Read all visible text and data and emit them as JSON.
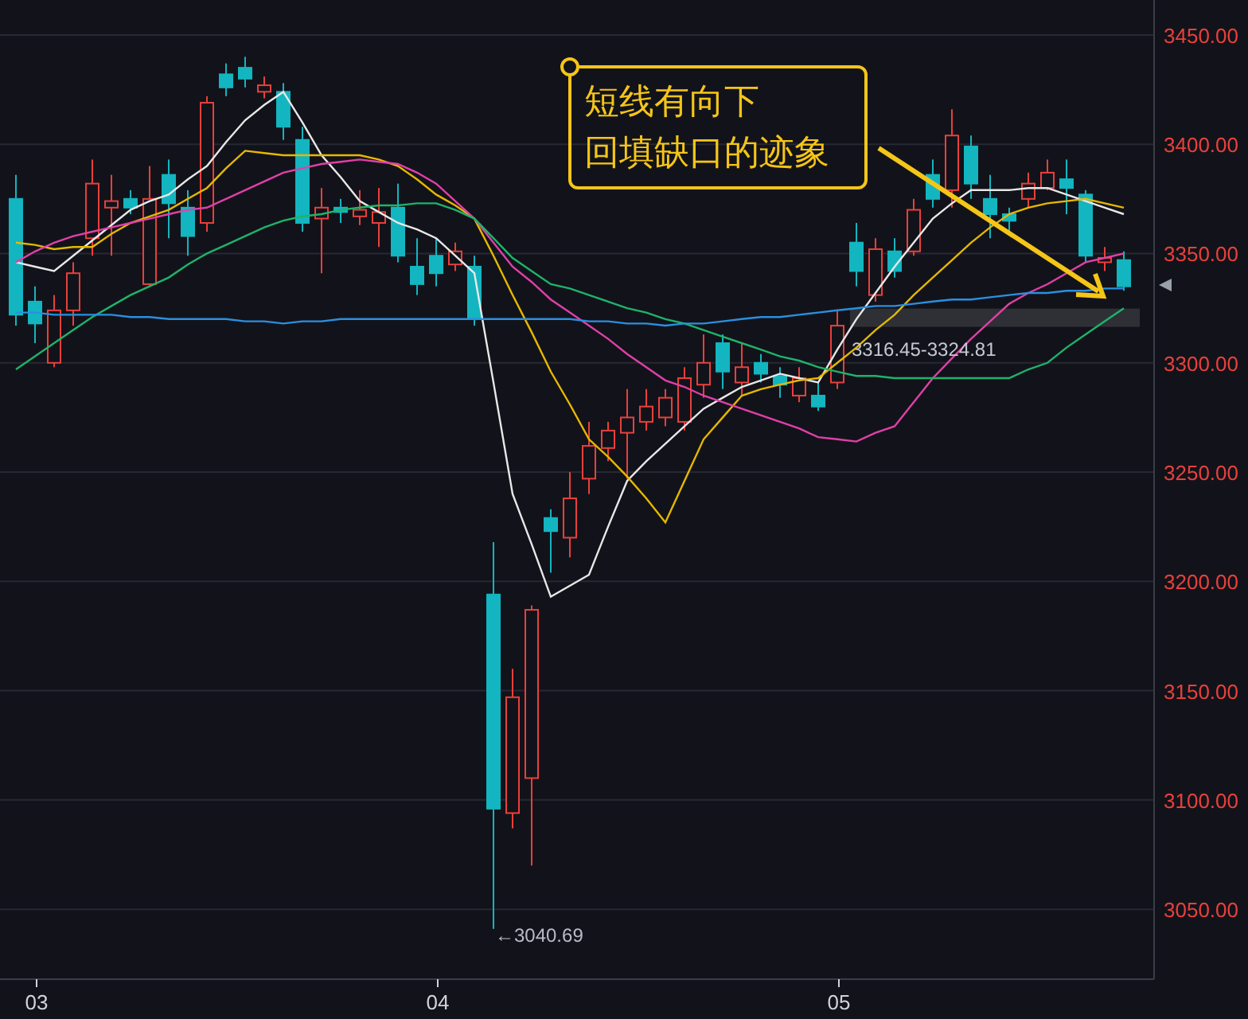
{
  "chart_data": {
    "type": "candlestick",
    "ylim": [
      3018,
      3466
    ],
    "grid": true,
    "categories": [
      null,
      "03",
      null,
      null,
      null,
      null,
      null,
      null,
      null,
      null,
      null,
      null,
      null,
      null,
      null,
      null,
      null,
      null,
      null,
      null,
      null,
      null,
      "04",
      null,
      null,
      null,
      null,
      null,
      null,
      null,
      null,
      null,
      null,
      null,
      null,
      null,
      null,
      null,
      null,
      null,
      null,
      null,
      null,
      "05",
      null,
      null,
      null,
      null,
      null,
      null,
      null,
      null,
      null,
      null,
      null,
      null,
      null,
      null,
      null
    ],
    "yticks": [
      {
        "value": 3450,
        "label": "3450.00"
      },
      {
        "value": 3400,
        "label": "3400.00"
      },
      {
        "value": 3350,
        "label": "3350.00"
      },
      {
        "value": 3300,
        "label": "3300.00"
      },
      {
        "value": 3250,
        "label": "3250.00"
      },
      {
        "value": 3200,
        "label": "3200.00"
      },
      {
        "value": 3150,
        "label": "3150.00"
      },
      {
        "value": 3100,
        "label": "3100.00"
      },
      {
        "value": 3050,
        "label": "3050.00"
      }
    ],
    "ohlc": [
      [
        3375,
        3386,
        3317,
        3322
      ],
      [
        3328,
        3335,
        3309,
        3318
      ],
      [
        3300,
        3331,
        3298,
        3324
      ],
      [
        3324,
        3346,
        3317,
        3341
      ],
      [
        3357,
        3393,
        3349,
        3382
      ],
      [
        3371,
        3386,
        3349,
        3374
      ],
      [
        3375,
        3379,
        3368,
        3371
      ],
      [
        3336,
        3390,
        3335,
        3375
      ],
      [
        3386,
        3393,
        3357,
        3373
      ],
      [
        3371,
        3379,
        3349,
        3358
      ],
      [
        3364,
        3422,
        3360,
        3419
      ],
      [
        3432,
        3437,
        3422,
        3426
      ],
      [
        3435,
        3440,
        3426,
        3430
      ],
      [
        3424,
        3431,
        3421,
        3427
      ],
      [
        3424,
        3428,
        3402,
        3408
      ],
      [
        3402,
        3408,
        3360,
        3364
      ],
      [
        3366,
        3380,
        3341,
        3371
      ],
      [
        3371,
        3375,
        3364,
        3369
      ],
      [
        3367,
        3379,
        3363,
        3370
      ],
      [
        3364,
        3380,
        3353,
        3369
      ],
      [
        3371,
        3382,
        3346,
        3349
      ],
      [
        3344,
        3357,
        3331,
        3336
      ],
      [
        3349,
        3357,
        3335,
        3341
      ],
      [
        3345,
        3355,
        3342,
        3351
      ],
      [
        3344,
        3349,
        3317,
        3320
      ],
      [
        3194,
        3218,
        3041,
        3096
      ],
      [
        3094,
        3160,
        3087,
        3147
      ],
      [
        3110,
        3189,
        3070,
        3187
      ],
      [
        3229,
        3233,
        3204,
        3223
      ],
      [
        3220,
        3250,
        3211,
        3238
      ],
      [
        3247,
        3273,
        3240,
        3262
      ],
      [
        3261,
        3273,
        3255,
        3269
      ],
      [
        3268,
        3288,
        3247,
        3275
      ],
      [
        3273,
        3288,
        3269,
        3280
      ],
      [
        3275,
        3288,
        3271,
        3284
      ],
      [
        3273,
        3298,
        3269,
        3293
      ],
      [
        3290,
        3313,
        3284,
        3300
      ],
      [
        3309,
        3313,
        3288,
        3296
      ],
      [
        3291,
        3309,
        3285,
        3298
      ],
      [
        3300,
        3304,
        3291,
        3295
      ],
      [
        3294,
        3298,
        3284,
        3290
      ],
      [
        3285,
        3298,
        3282,
        3293
      ],
      [
        3285,
        3291,
        3278,
        3280
      ],
      [
        3291,
        3324,
        3288,
        3317
      ],
      [
        3355,
        3364,
        3335,
        3342
      ],
      [
        3331,
        3357,
        3328,
        3352
      ],
      [
        3351,
        3357,
        3339,
        3342
      ],
      [
        3351,
        3375,
        3349,
        3370
      ],
      [
        3386,
        3393,
        3371,
        3375
      ],
      [
        3379,
        3416,
        3371,
        3404
      ],
      [
        3399,
        3404,
        3375,
        3382
      ],
      [
        3375,
        3386,
        3357,
        3368
      ],
      [
        3368,
        3371,
        3360,
        3365
      ],
      [
        3375,
        3387,
        3371,
        3382
      ],
      [
        3380,
        3393,
        3379,
        3387
      ],
      [
        3384,
        3393,
        3368,
        3380
      ],
      [
        3377,
        3379,
        3346,
        3349
      ],
      [
        3346,
        3353,
        3342,
        3348
      ],
      [
        3347,
        3351,
        3333,
        3335
      ]
    ],
    "series": [
      {
        "type": "line",
        "color": "#e8e8e8",
        "values": [
          3346,
          3344,
          3342,
          3349,
          3356,
          3363,
          3370,
          3374,
          3377,
          3384,
          3390,
          3401,
          3411,
          3418,
          3424,
          3410,
          3395,
          3385,
          3374,
          3369,
          3364,
          3361,
          3357,
          3349,
          3341,
          3291,
          3240,
          3217,
          3193,
          3198,
          3203,
          3225,
          3246,
          3255,
          3263,
          3271,
          3279,
          3284,
          3289,
          3292,
          3295,
          3293,
          3291,
          3306,
          3320,
          3332,
          3344,
          3355,
          3366,
          3373,
          3379,
          3379,
          3379,
          3380,
          3380,
          3377,
          3374,
          3371,
          3368
        ]
      },
      {
        "type": "line",
        "color": "#e6b800",
        "values": [
          3355,
          3354,
          3352,
          3353,
          3353,
          3359,
          3364,
          3367,
          3370,
          3375,
          3380,
          3389,
          3397,
          3396,
          3395,
          3395,
          3395,
          3395,
          3395,
          3393,
          3390,
          3384,
          3377,
          3372,
          3366,
          3349,
          3331,
          3314,
          3296,
          3281,
          3265,
          3257,
          3248,
          3238,
          3227,
          3246,
          3265,
          3275,
          3285,
          3288,
          3290,
          3292,
          3293,
          3300,
          3307,
          3315,
          3322,
          3331,
          3339,
          3347,
          3355,
          3362,
          3368,
          3371,
          3373,
          3374,
          3375,
          3373,
          3371
        ]
      },
      {
        "type": "line",
        "color": "#e040a8",
        "values": [
          3346,
          3351,
          3355,
          3358,
          3360,
          3362,
          3364,
          3366,
          3368,
          3370,
          3371,
          3375,
          3379,
          3383,
          3387,
          3389,
          3391,
          3392,
          3393,
          3392,
          3391,
          3387,
          3382,
          3374,
          3366,
          3355,
          3344,
          3337,
          3329,
          3323,
          3317,
          3311,
          3304,
          3298,
          3292,
          3289,
          3285,
          3282,
          3279,
          3276,
          3273,
          3270,
          3266,
          3265,
          3264,
          3268,
          3271,
          3282,
          3293,
          3302,
          3311,
          3319,
          3327,
          3332,
          3336,
          3341,
          3346,
          3348,
          3350
        ]
      },
      {
        "type": "line",
        "color": "#1fb36a",
        "values": [
          3297,
          3303,
          3309,
          3315,
          3321,
          3326,
          3331,
          3335,
          3339,
          3345,
          3350,
          3354,
          3358,
          3362,
          3365,
          3367,
          3368,
          3370,
          3371,
          3372,
          3372,
          3373,
          3373,
          3370,
          3366,
          3357,
          3348,
          3342,
          3336,
          3334,
          3331,
          3328,
          3325,
          3323,
          3320,
          3318,
          3315,
          3312,
          3309,
          3306,
          3303,
          3301,
          3298,
          3296,
          3294,
          3294,
          3293,
          3293,
          3293,
          3293,
          3293,
          3293,
          3293,
          3297,
          3300,
          3307,
          3313,
          3319,
          3325
        ]
      },
      {
        "type": "line",
        "color": "#2a8fe0",
        "values": [
          3323,
          3323,
          3322,
          3322,
          3322,
          3322,
          3321,
          3321,
          3320,
          3320,
          3320,
          3320,
          3319,
          3319,
          3318,
          3319,
          3319,
          3320,
          3320,
          3320,
          3320,
          3320,
          3320,
          3320,
          3320,
          3320,
          3320,
          3320,
          3320,
          3320,
          3319,
          3319,
          3318,
          3318,
          3317,
          3318,
          3318,
          3319,
          3320,
          3321,
          3321,
          3322,
          3323,
          3324,
          3325,
          3326,
          3326,
          3327,
          3328,
          3329,
          3329,
          3330,
          3331,
          3332,
          3332,
          3333,
          3333,
          3334,
          3334
        ]
      }
    ],
    "bands": [
      {
        "axis": "y",
        "from": 3316.45,
        "to": 3324.81,
        "label": "3316.45-3324.81"
      }
    ],
    "annotations": [
      "短线有向下",
      "回填缺口的迹象",
      "←3040.69"
    ]
  }
}
